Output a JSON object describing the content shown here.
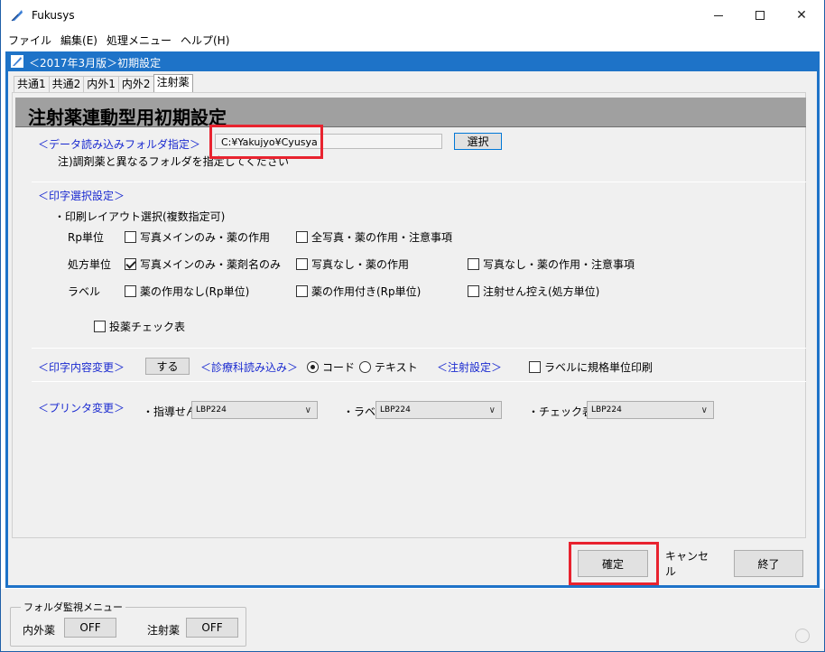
{
  "window": {
    "title": "Fukusys"
  },
  "menu": [
    "ファイル",
    "編集(E)",
    "処理メニュー",
    "ヘルプ(H)"
  ],
  "child_window": {
    "title": "＜2017年3月版＞初期設定"
  },
  "tabs": [
    "共通1",
    "共通2",
    "内外1",
    "内外2",
    "注射薬"
  ],
  "header": {
    "title": "注射薬連動型用初期設定"
  },
  "folder": {
    "label": "＜データ読み込みフォルダ指定＞",
    "path": "C:¥Yakujyo¥Cyusya",
    "select_button": "選択",
    "note": "注)調剤薬と異なるフォルダを指定してください"
  },
  "print_select": {
    "label": "＜印字選択設定＞",
    "layout_label": "・印刷レイアウト選択(複数指定可)",
    "rows": [
      {
        "label": "Rp単位",
        "options": [
          {
            "text": "写真メインのみ・薬の作用",
            "checked": false
          },
          {
            "text": "全写真・薬の作用・注意事項",
            "checked": false
          }
        ]
      },
      {
        "label": "処方単位",
        "options": [
          {
            "text": "写真メインのみ・薬剤名のみ",
            "checked": true
          },
          {
            "text": "写真なし・薬の作用",
            "checked": false
          },
          {
            "text": "写真なし・薬の作用・注意事項",
            "checked": false
          }
        ]
      },
      {
        "label": "ラベル",
        "options": [
          {
            "text": "薬の作用なし(Rp単位)",
            "checked": false
          },
          {
            "text": "薬の作用付き(Rp単位)",
            "checked": false
          },
          {
            "text": "注射せん控え(処方単位)",
            "checked": false
          }
        ]
      }
    ],
    "drug_check": {
      "text": "投薬チェック表",
      "checked": false
    }
  },
  "print_change": {
    "label": "＜印字内容変更＞",
    "button": "する",
    "dept_label": "＜診療科読み込み＞",
    "radio_code": "コード",
    "radio_text": "テキスト",
    "injection_label": "＜注射設定＞",
    "spec_unit": "ラベルに規格単位印刷"
  },
  "printer": {
    "label": "＜プリンタ変更＞",
    "guidance_label": "・指導せん",
    "guidance_value": "LBP224",
    "label_label": "・ラベル",
    "label_value": "LBP224",
    "check_label": "・チェック表類",
    "check_value": "LBP224"
  },
  "buttons": {
    "ok": "確定",
    "cancel": "キャンセル",
    "exit": "終了"
  },
  "monitor": {
    "title": "フォルダ監視メニュー",
    "inner_label": "内外薬",
    "inner_value": "OFF",
    "injection_label": "注射薬",
    "injection_value": "OFF"
  },
  "colors": {
    "section_label": "#1a2ad0",
    "mdi_frame": "#1e73c8",
    "highlight": "#e8232f"
  }
}
